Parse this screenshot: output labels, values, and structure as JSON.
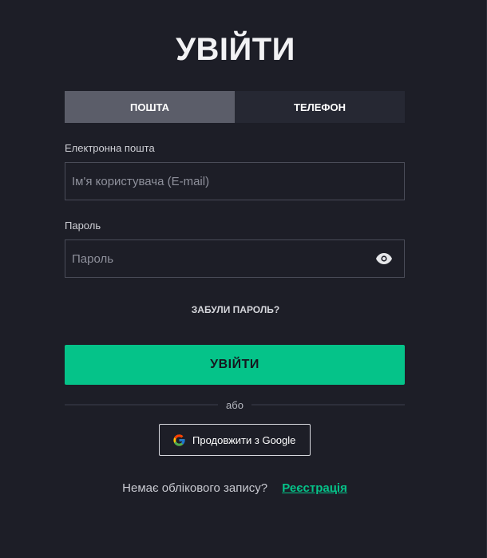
{
  "title": "УВІЙТИ",
  "tabs": [
    {
      "label": "ПОШТА",
      "active": true
    },
    {
      "label": "ТЕЛЕФОН",
      "active": false
    }
  ],
  "email": {
    "label": "Електронна пошта",
    "placeholder": "Ім'я користувача (E-mail)",
    "value": ""
  },
  "password": {
    "label": "Пароль",
    "placeholder": "Пароль",
    "value": "",
    "toggle_icon": "eye-icon"
  },
  "forgot_label": "ЗАБУЛИ ПАРОЛЬ?",
  "submit_label": "УВІЙТИ",
  "divider_text": "або",
  "google": {
    "label": "Продовжити з Google",
    "icon": "google-icon"
  },
  "footer": {
    "prompt": "Немає облікового запису?",
    "link": "Реєстрація"
  },
  "colors": {
    "background": "#1d1e27",
    "accent": "#05c389",
    "tab_active": "#5b5d69",
    "tab_inactive": "#262833"
  }
}
